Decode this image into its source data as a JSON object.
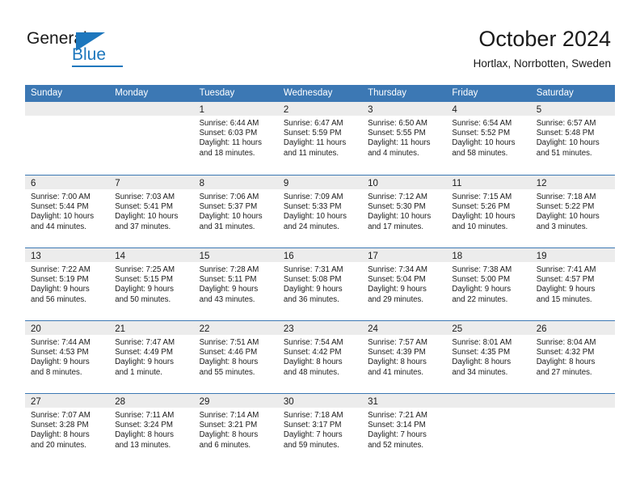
{
  "logo": {
    "word_one": "General",
    "word_two": "Blue",
    "accent_color": "#1d77bd"
  },
  "header": {
    "title": "October 2024",
    "location": "Hortlax, Norrbotten, Sweden"
  },
  "theme": {
    "header_bar_color": "#3c78b4",
    "daynum_band_color": "#ececec",
    "text_color": "#1a1a1a"
  },
  "weekdays": [
    "Sunday",
    "Monday",
    "Tuesday",
    "Wednesday",
    "Thursday",
    "Friday",
    "Saturday"
  ],
  "weeks": [
    [
      {
        "day": "",
        "sunrise": "",
        "sunset": "",
        "daylight_line1": "",
        "daylight_line2": "",
        "empty": true
      },
      {
        "day": "",
        "sunrise": "",
        "sunset": "",
        "daylight_line1": "",
        "daylight_line2": "",
        "empty": true
      },
      {
        "day": "1",
        "sunrise": "Sunrise: 6:44 AM",
        "sunset": "Sunset: 6:03 PM",
        "daylight_line1": "Daylight: 11 hours",
        "daylight_line2": "and 18 minutes."
      },
      {
        "day": "2",
        "sunrise": "Sunrise: 6:47 AM",
        "sunset": "Sunset: 5:59 PM",
        "daylight_line1": "Daylight: 11 hours",
        "daylight_line2": "and 11 minutes."
      },
      {
        "day": "3",
        "sunrise": "Sunrise: 6:50 AM",
        "sunset": "Sunset: 5:55 PM",
        "daylight_line1": "Daylight: 11 hours",
        "daylight_line2": "and 4 minutes."
      },
      {
        "day": "4",
        "sunrise": "Sunrise: 6:54 AM",
        "sunset": "Sunset: 5:52 PM",
        "daylight_line1": "Daylight: 10 hours",
        "daylight_line2": "and 58 minutes."
      },
      {
        "day": "5",
        "sunrise": "Sunrise: 6:57 AM",
        "sunset": "Sunset: 5:48 PM",
        "daylight_line1": "Daylight: 10 hours",
        "daylight_line2": "and 51 minutes."
      }
    ],
    [
      {
        "day": "6",
        "sunrise": "Sunrise: 7:00 AM",
        "sunset": "Sunset: 5:44 PM",
        "daylight_line1": "Daylight: 10 hours",
        "daylight_line2": "and 44 minutes."
      },
      {
        "day": "7",
        "sunrise": "Sunrise: 7:03 AM",
        "sunset": "Sunset: 5:41 PM",
        "daylight_line1": "Daylight: 10 hours",
        "daylight_line2": "and 37 minutes."
      },
      {
        "day": "8",
        "sunrise": "Sunrise: 7:06 AM",
        "sunset": "Sunset: 5:37 PM",
        "daylight_line1": "Daylight: 10 hours",
        "daylight_line2": "and 31 minutes."
      },
      {
        "day": "9",
        "sunrise": "Sunrise: 7:09 AM",
        "sunset": "Sunset: 5:33 PM",
        "daylight_line1": "Daylight: 10 hours",
        "daylight_line2": "and 24 minutes."
      },
      {
        "day": "10",
        "sunrise": "Sunrise: 7:12 AM",
        "sunset": "Sunset: 5:30 PM",
        "daylight_line1": "Daylight: 10 hours",
        "daylight_line2": "and 17 minutes."
      },
      {
        "day": "11",
        "sunrise": "Sunrise: 7:15 AM",
        "sunset": "Sunset: 5:26 PM",
        "daylight_line1": "Daylight: 10 hours",
        "daylight_line2": "and 10 minutes."
      },
      {
        "day": "12",
        "sunrise": "Sunrise: 7:18 AM",
        "sunset": "Sunset: 5:22 PM",
        "daylight_line1": "Daylight: 10 hours",
        "daylight_line2": "and 3 minutes."
      }
    ],
    [
      {
        "day": "13",
        "sunrise": "Sunrise: 7:22 AM",
        "sunset": "Sunset: 5:19 PM",
        "daylight_line1": "Daylight: 9 hours",
        "daylight_line2": "and 56 minutes."
      },
      {
        "day": "14",
        "sunrise": "Sunrise: 7:25 AM",
        "sunset": "Sunset: 5:15 PM",
        "daylight_line1": "Daylight: 9 hours",
        "daylight_line2": "and 50 minutes."
      },
      {
        "day": "15",
        "sunrise": "Sunrise: 7:28 AM",
        "sunset": "Sunset: 5:11 PM",
        "daylight_line1": "Daylight: 9 hours",
        "daylight_line2": "and 43 minutes."
      },
      {
        "day": "16",
        "sunrise": "Sunrise: 7:31 AM",
        "sunset": "Sunset: 5:08 PM",
        "daylight_line1": "Daylight: 9 hours",
        "daylight_line2": "and 36 minutes."
      },
      {
        "day": "17",
        "sunrise": "Sunrise: 7:34 AM",
        "sunset": "Sunset: 5:04 PM",
        "daylight_line1": "Daylight: 9 hours",
        "daylight_line2": "and 29 minutes."
      },
      {
        "day": "18",
        "sunrise": "Sunrise: 7:38 AM",
        "sunset": "Sunset: 5:00 PM",
        "daylight_line1": "Daylight: 9 hours",
        "daylight_line2": "and 22 minutes."
      },
      {
        "day": "19",
        "sunrise": "Sunrise: 7:41 AM",
        "sunset": "Sunset: 4:57 PM",
        "daylight_line1": "Daylight: 9 hours",
        "daylight_line2": "and 15 minutes."
      }
    ],
    [
      {
        "day": "20",
        "sunrise": "Sunrise: 7:44 AM",
        "sunset": "Sunset: 4:53 PM",
        "daylight_line1": "Daylight: 9 hours",
        "daylight_line2": "and 8 minutes."
      },
      {
        "day": "21",
        "sunrise": "Sunrise: 7:47 AM",
        "sunset": "Sunset: 4:49 PM",
        "daylight_line1": "Daylight: 9 hours",
        "daylight_line2": "and 1 minute."
      },
      {
        "day": "22",
        "sunrise": "Sunrise: 7:51 AM",
        "sunset": "Sunset: 4:46 PM",
        "daylight_line1": "Daylight: 8 hours",
        "daylight_line2": "and 55 minutes."
      },
      {
        "day": "23",
        "sunrise": "Sunrise: 7:54 AM",
        "sunset": "Sunset: 4:42 PM",
        "daylight_line1": "Daylight: 8 hours",
        "daylight_line2": "and 48 minutes."
      },
      {
        "day": "24",
        "sunrise": "Sunrise: 7:57 AM",
        "sunset": "Sunset: 4:39 PM",
        "daylight_line1": "Daylight: 8 hours",
        "daylight_line2": "and 41 minutes."
      },
      {
        "day": "25",
        "sunrise": "Sunrise: 8:01 AM",
        "sunset": "Sunset: 4:35 PM",
        "daylight_line1": "Daylight: 8 hours",
        "daylight_line2": "and 34 minutes."
      },
      {
        "day": "26",
        "sunrise": "Sunrise: 8:04 AM",
        "sunset": "Sunset: 4:32 PM",
        "daylight_line1": "Daylight: 8 hours",
        "daylight_line2": "and 27 minutes."
      }
    ],
    [
      {
        "day": "27",
        "sunrise": "Sunrise: 7:07 AM",
        "sunset": "Sunset: 3:28 PM",
        "daylight_line1": "Daylight: 8 hours",
        "daylight_line2": "and 20 minutes."
      },
      {
        "day": "28",
        "sunrise": "Sunrise: 7:11 AM",
        "sunset": "Sunset: 3:24 PM",
        "daylight_line1": "Daylight: 8 hours",
        "daylight_line2": "and 13 minutes."
      },
      {
        "day": "29",
        "sunrise": "Sunrise: 7:14 AM",
        "sunset": "Sunset: 3:21 PM",
        "daylight_line1": "Daylight: 8 hours",
        "daylight_line2": "and 6 minutes."
      },
      {
        "day": "30",
        "sunrise": "Sunrise: 7:18 AM",
        "sunset": "Sunset: 3:17 PM",
        "daylight_line1": "Daylight: 7 hours",
        "daylight_line2": "and 59 minutes."
      },
      {
        "day": "31",
        "sunrise": "Sunrise: 7:21 AM",
        "sunset": "Sunset: 3:14 PM",
        "daylight_line1": "Daylight: 7 hours",
        "daylight_line2": "and 52 minutes."
      },
      {
        "day": "",
        "sunrise": "",
        "sunset": "",
        "daylight_line1": "",
        "daylight_line2": "",
        "empty": true
      },
      {
        "day": "",
        "sunrise": "",
        "sunset": "",
        "daylight_line1": "",
        "daylight_line2": "",
        "empty": true
      }
    ]
  ]
}
